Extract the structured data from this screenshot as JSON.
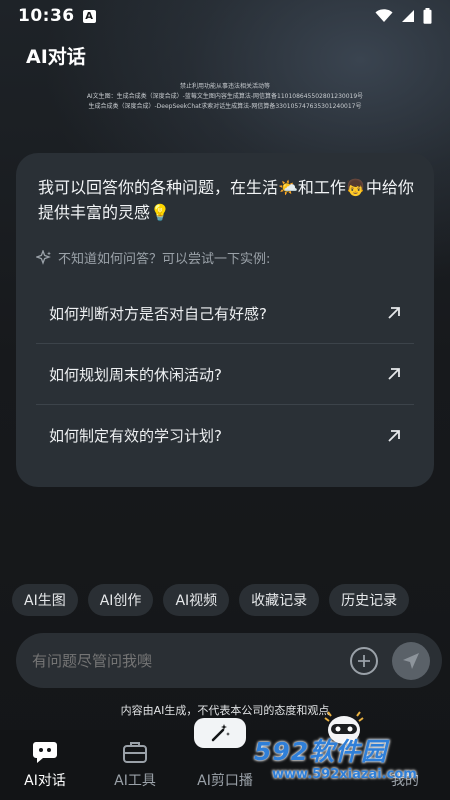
{
  "status_bar": {
    "time": "10:36",
    "badge": "A"
  },
  "app": {
    "title": "AI对话"
  },
  "notice": {
    "line1": "禁止利用功能从事违法相关活动等",
    "line2": "AI文生图：生成合成类（深度合成）-蓝莓文生图内容生成算法-网信算备110108645502801230019号",
    "line3": "生成合成类（深度合成）-DeepSeekChat求索对话生成算法-网信算备330105747635301240017号"
  },
  "card": {
    "intro": "我可以回答你的各种问题，在生活🌤️和工作👦中给你提供丰富的灵感💡",
    "hint": "不知道如何问答？可以尝试一下实例:",
    "questions": [
      "如何判断对方是否对自己有好感?",
      "如何规划周末的休闲活动?",
      "如何制定有效的学习计划?"
    ]
  },
  "chips": [
    "AI生图",
    "AI创作",
    "AI视频",
    "收藏记录",
    "历史记录"
  ],
  "input": {
    "placeholder": "有问题尽管问我噢"
  },
  "disclaimer": "内容由AI生成，不代表本公司的态度和观点",
  "tabs": [
    {
      "label": "AI对话",
      "icon": "chat-bubble-icon",
      "active": true
    },
    {
      "label": "AI工具",
      "icon": "toolbox-icon",
      "active": false
    },
    {
      "label": "AI剪口播",
      "icon": "magic-wand-icon",
      "active": false
    },
    {
      "label": "",
      "icon": "",
      "active": false
    },
    {
      "label": "我的",
      "icon": "profile-icon",
      "active": false
    }
  ],
  "watermark": {
    "main": "592软件园",
    "sub": "www.592xiazai.com"
  },
  "colors": {
    "background": "#151719",
    "card": "#2a3036",
    "chip": "#2a2f34",
    "watermark": "#2f7fd8"
  }
}
